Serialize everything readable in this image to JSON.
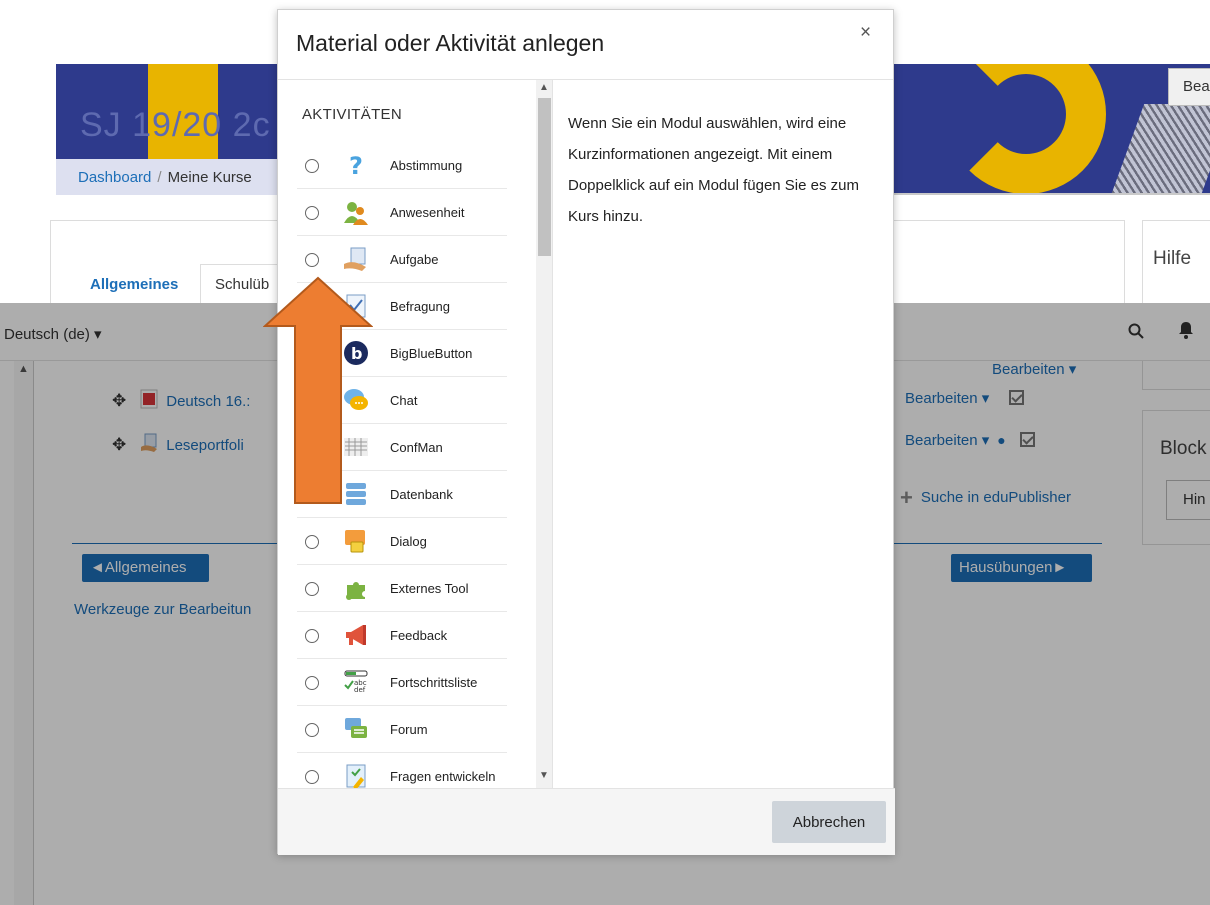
{
  "background": {
    "banner_title": "SJ 19/20 2c",
    "breadcrumb": {
      "dashboard": "Dashboard",
      "separator": "/",
      "my_courses": "Meine Kurse"
    },
    "top_edit_button": "Bea",
    "tabs": {
      "active": "Allgemeines",
      "second": "Schulüb"
    },
    "side": {
      "help_title": "Hilfe",
      "blocks_title": "Block",
      "hide_button": "Hin"
    },
    "navbar": {
      "language": "Deutsch (de) ▾",
      "search_icon": "search-icon",
      "bell_icon": "bell-icon"
    },
    "section_edit_top": "Bearbeiten ▾",
    "items": [
      {
        "label": "Deutsch 16.:",
        "edit": "Bearbeiten ▾"
      },
      {
        "label": "Leseportfoli",
        "edit": "Bearbeiten ▾"
      }
    ],
    "edupublisher_link": "Suche in eduPublisher",
    "prev_section_button": "◄Allgemeines",
    "next_section_button": "Hausübungen►",
    "tools_link": "Werkzeuge zur Bearbeitun"
  },
  "modal": {
    "title": "Material oder Aktivität anlegen",
    "close": "×",
    "list_heading": "AKTIVITÄTEN",
    "activities": [
      {
        "label": "Abstimmung",
        "icon": "question-icon"
      },
      {
        "label": "Anwesenheit",
        "icon": "attendance-icon"
      },
      {
        "label": "Aufgabe",
        "icon": "assignment-icon"
      },
      {
        "label": "Befragung",
        "icon": "survey-icon"
      },
      {
        "label": "BigBlueButton",
        "icon": "bigbluebutton-icon"
      },
      {
        "label": "Chat",
        "icon": "chat-icon"
      },
      {
        "label": "ConfMan",
        "icon": "confman-icon"
      },
      {
        "label": "Datenbank",
        "icon": "database-icon"
      },
      {
        "label": "Dialog",
        "icon": "dialog-icon"
      },
      {
        "label": "Externes Tool",
        "icon": "puzzle-icon"
      },
      {
        "label": "Feedback",
        "icon": "megaphone-icon"
      },
      {
        "label": "Fortschrittsliste",
        "icon": "checklist-icon"
      },
      {
        "label": "Forum",
        "icon": "forum-icon"
      },
      {
        "label": "Fragen entwickeln",
        "icon": "question-develop-icon"
      }
    ],
    "info_text": "Wenn Sie ein Modul auswählen, wird eine Kurzinformationen angezeigt. Mit einem Doppelklick auf ein Modul fügen Sie es zum Kurs hinzu.",
    "cancel_button": "Abbrechen"
  },
  "colors": {
    "link": "#1d6fb8",
    "arrow": "#ed7d31",
    "banner": "#2e3a8c",
    "accent_yellow": "#e8b400"
  }
}
